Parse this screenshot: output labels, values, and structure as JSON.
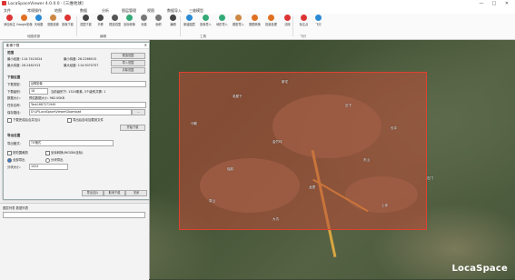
{
  "window": {
    "title": "LocaSpaceViewer 4.0.0.0 - [三维地球]",
    "min": "—",
    "max": "□",
    "close": "✕"
  },
  "menu": [
    "文件",
    "常规操作",
    "地图",
    "数据",
    "分析",
    "图层管理",
    "视图",
    "数据导入",
    "三维模型"
  ],
  "ribbon": {
    "buttons": [
      {
        "label": "添加标注",
        "icon": "pin-icon",
        "color": "#d33"
      },
      {
        "label": "Google影像",
        "icon": "globe-icon",
        "color": "#e07020"
      },
      {
        "label": "天地图",
        "icon": "map-icon",
        "color": "#2a8ad4"
      },
      {
        "label": "底图设置",
        "icon": "layer-icon",
        "color": "#c84"
      },
      {
        "label": "影像下载",
        "icon": "download-icon",
        "color": "#d33"
      },
      {
        "label": "范围下载",
        "icon": "cursor-icon",
        "color": "#444"
      },
      {
        "label": "平移",
        "icon": "move-icon",
        "color": "#444"
      },
      {
        "label": "框选范围",
        "icon": "select-icon",
        "color": "#555"
      },
      {
        "label": "坐标转换",
        "icon": "convert-icon",
        "color": "#3a7"
      },
      {
        "label": "测量",
        "icon": "measure-icon",
        "color": "#777"
      },
      {
        "label": "面积",
        "icon": "area-icon",
        "color": "#777"
      },
      {
        "label": "编辑",
        "icon": "edit-icon",
        "color": "#444"
      },
      {
        "label": "新建图层",
        "icon": "new-layer-icon",
        "color": "#2a8ad4"
      },
      {
        "label": "影像导入",
        "icon": "import-image-icon",
        "color": "#3a7"
      },
      {
        "label": "地形导入",
        "icon": "import-terrain-icon",
        "color": "#3a7"
      },
      {
        "label": "模型导入",
        "icon": "import-model-icon",
        "color": "#c84"
      },
      {
        "label": "数据转换",
        "icon": "convert-data-icon",
        "color": "#e07020"
      },
      {
        "label": "批量处理",
        "icon": "batch-icon",
        "color": "#e07020"
      },
      {
        "label": "清除",
        "icon": "clear-icon",
        "color": "#d33"
      },
      {
        "label": "标注点",
        "icon": "marker-icon",
        "color": "#d33"
      },
      {
        "label": "飞行",
        "icon": "fly-icon",
        "color": "#2a8ad4"
      }
    ],
    "groups": [
      {
        "label": "地图资源"
      },
      {
        "label": "编辑"
      },
      {
        "label": "工具"
      },
      {
        "label": "飞行"
      }
    ]
  },
  "dialog": {
    "title": "影像下载",
    "close": "✕",
    "section_range": "范围",
    "west_label": "最小经度: 114.7410024",
    "north_label": "最大纬度: 26.2461913",
    "east_label": "最小纬度: 26.2266015",
    "south_label": "最大经度: 114.9070707",
    "draw_range_btn": "框选范围",
    "import_range_btn": "导入范围",
    "clear_range_btn": "清除范围",
    "section_download": "下载设置",
    "source_label": "下载类型:",
    "source_value": "谷歌影像",
    "level_label": "下载级别:",
    "level_value": "18",
    "level_info": "当前级别下: 1324像素, 3个级别共需: 1",
    "size_label": "数据大小:",
    "size_value": "预估数据大小: 962.00KB",
    "taskname_label": "任务名称:",
    "taskname_value": "Task1687271949",
    "savepath_label": "保存路径:",
    "savepath_value": "D:\\LP\\LocaSpace\\Viewer\\Download",
    "browse_btn": "...",
    "opt_merge": "下载完成后合并瓦片",
    "opt_auto": "导出后自动加载到文件",
    "start_btn": "开始下载",
    "section_export": "导出设置",
    "format_label": "导出格式:",
    "format_value": "TIF格式",
    "opt_clip": "按范围裁剪",
    "opt_coord": "坐标转换(WGS84坐标)",
    "mode_full": "全部导出",
    "mode_split": "分块导出",
    "tile_label": "分块大小:",
    "tile_value": "1024",
    "btn_export": "导出瓦片",
    "btn_cancel": "取消下载",
    "btn_close": "关闭"
  },
  "bottom_panel": {
    "tabs": "图层列表   数据列表"
  },
  "map": {
    "labels": [
      "新宅",
      "老屋下",
      "石下",
      "马鞍",
      "长冲",
      "金竹坪",
      "瑶前",
      "东山",
      "龙潭",
      "茶山",
      "上坪",
      "大坑",
      "石门"
    ],
    "logo": "LocaSpace"
  }
}
